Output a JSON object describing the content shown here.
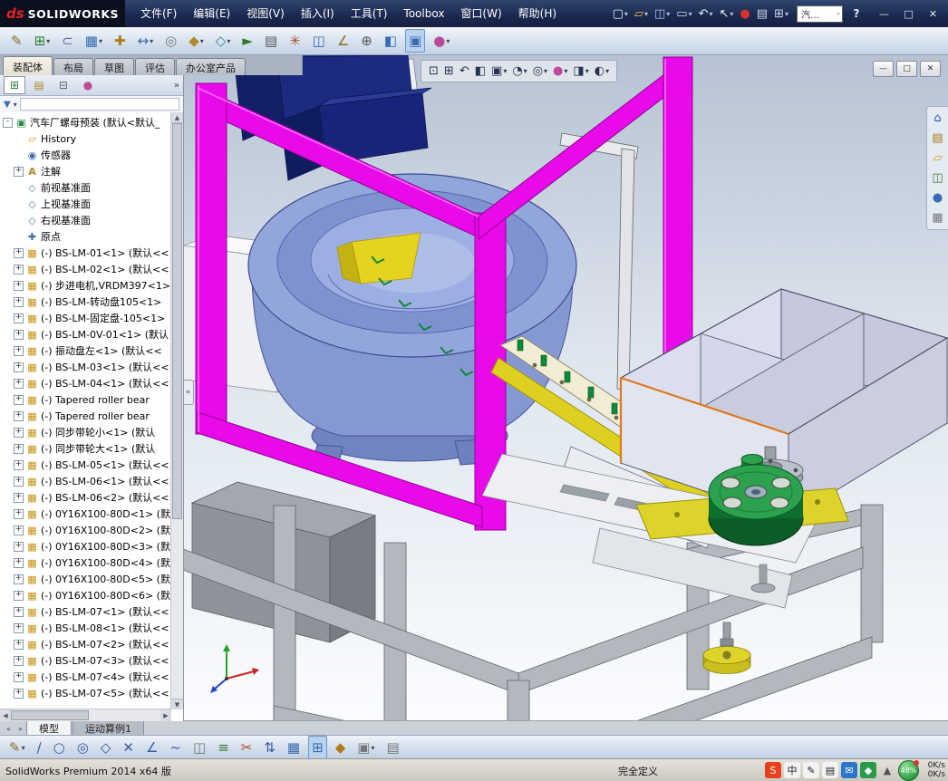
{
  "titlebar": {
    "logo_mark": "ds",
    "logo_name": "SOLIDWORKS",
    "menus": [
      "文件(F)",
      "编辑(E)",
      "视图(V)",
      "插入(I)",
      "工具(T)",
      "Toolbox",
      "窗口(W)",
      "帮助(H)"
    ],
    "qat": [
      {
        "name": "new-document-icon",
        "glyph": "▢",
        "color": "#e8ecf6",
        "dd": "▾"
      },
      {
        "name": "open-document-icon",
        "glyph": "▱",
        "color": "#f0c24a",
        "dd": "▾"
      },
      {
        "name": "save-icon",
        "glyph": "◫",
        "color": "#9fc3ee",
        "dd": "▾"
      },
      {
        "name": "print-icon",
        "glyph": "▭",
        "color": "#cdd5e4",
        "dd": "▾"
      },
      {
        "name": "undo-icon",
        "glyph": "↶",
        "color": "#e8ecf6",
        "dd": "▾"
      },
      {
        "name": "select-icon",
        "glyph": "↖",
        "color": "#eef2f8",
        "dd": "▾"
      },
      {
        "name": "record-macro-icon",
        "glyph": "●",
        "color": "#d83030"
      },
      {
        "name": "file-properties-icon",
        "glyph": "▤",
        "color": "#cdd5e4"
      },
      {
        "name": "options-icon",
        "glyph": "⊞",
        "color": "#cdd5e4",
        "dd": "▾"
      }
    ],
    "search_value": "汽…",
    "search_dd": "▾",
    "help_glyph": "?",
    "window_controls": [
      {
        "name": "minimize-button",
        "glyph": "—"
      },
      {
        "name": "maximize-button",
        "glyph": "□"
      },
      {
        "name": "close-button",
        "glyph": "✕"
      }
    ]
  },
  "toolbar2": {
    "icons": [
      {
        "name": "edit-component-icon",
        "glyph": "✎",
        "color": "#8a6d1a"
      },
      {
        "name": "insert-components-icon",
        "glyph": "⊞",
        "color": "#2f7a2f",
        "dd": "▾"
      },
      {
        "name": "mate-icon",
        "glyph": "⊂",
        "color": "#6a6a9a"
      },
      {
        "name": "linear-component-pattern-icon",
        "glyph": "▦",
        "color": "#3a6ab0",
        "dd": "▾"
      },
      {
        "name": "smart-fasteners-icon",
        "glyph": "✚",
        "color": "#b07a1a"
      },
      {
        "name": "move-component-icon",
        "glyph": "↔",
        "color": "#3a6ab0",
        "dd": "▾"
      },
      {
        "name": "show-hidden-components-icon",
        "glyph": "◎",
        "color": "#777777"
      },
      {
        "name": "assembly-features-icon",
        "glyph": "◆",
        "color": "#b08a2a",
        "dd": "▾"
      },
      {
        "name": "reference-geometry-icon",
        "glyph": "◇",
        "color": "#2a8a8a",
        "dd": "▾"
      },
      {
        "name": "new-motion-study-icon",
        "glyph": "►",
        "color": "#2a7a2a"
      },
      {
        "name": "bill-of-materials-icon",
        "glyph": "▤",
        "color": "#555555"
      },
      {
        "name": "exploded-view-icon",
        "glyph": "✳",
        "color": "#b04a2a"
      },
      {
        "name": "interference-detection-icon",
        "glyph": "◫",
        "color": "#3a6ab0"
      },
      {
        "name": "measure-icon",
        "glyph": "∠",
        "color": "#8a6d1a"
      },
      {
        "name": "mass-properties-icon",
        "glyph": "⊕",
        "color": "#555555"
      },
      {
        "name": "section-view-icon",
        "glyph": "◧",
        "color": "#3a6ab0"
      },
      {
        "name": "large-assembly-mode-icon",
        "glyph": "▣",
        "color": "#3a6ab0",
        "cls": "pressed"
      },
      {
        "name": "appearance-icon",
        "glyph": "●",
        "color": "#c04a9a",
        "dd": "▾"
      }
    ]
  },
  "command_tabs": [
    {
      "label": "装配体",
      "cls": "active"
    },
    {
      "label": "布局"
    },
    {
      "label": "草图"
    },
    {
      "label": "评估"
    },
    {
      "label": "办公室产品"
    }
  ],
  "fm": {
    "tabs": [
      {
        "name": "featuremanager-tree-tab-icon",
        "glyph": "⊞",
        "color": "#2f7a2f",
        "cls": "active"
      },
      {
        "name": "propertymanager-tab-icon",
        "glyph": "▤",
        "color": "#b08a2a"
      },
      {
        "name": "configurationmanager-tab-icon",
        "glyph": "⊟",
        "color": "#666666"
      },
      {
        "name": "displaymanager-tab-icon",
        "glyph": "●",
        "color": "#c04a9a"
      }
    ],
    "more_glyph": "»",
    "filter_glyph": "▼",
    "filter_dd": "▾"
  },
  "tree": {
    "items": [
      {
        "t": "汽车厂螺母预装 (默认<默认_",
        "g": "▣",
        "c": "#2f8a4a",
        "e": "-",
        "lv": "lv0"
      },
      {
        "t": "History",
        "g": "▱",
        "c": "#d8a020",
        "e": "",
        "lv": "lv1"
      },
      {
        "t": "传感器",
        "g": "◉",
        "c": "#3a6ab0",
        "e": "",
        "lv": "lv1"
      },
      {
        "t": "注解",
        "g": "A",
        "c": "#b08a2a",
        "e": "+",
        "lv": "lv1"
      },
      {
        "t": "前视基准面",
        "g": "◇",
        "c": "#4a8a9a",
        "e": "",
        "lv": "lv1"
      },
      {
        "t": "上视基准面",
        "g": "◇",
        "c": "#4a8a9a",
        "e": "",
        "lv": "lv1"
      },
      {
        "t": "右视基准面",
        "g": "◇",
        "c": "#4a8a9a",
        "e": "",
        "lv": "lv1"
      },
      {
        "t": "原点",
        "g": "✚",
        "c": "#3a6ab0",
        "e": "",
        "lv": "lv1"
      },
      {
        "t": "(-) BS-LM-01<1> (默认<<",
        "g": "▦",
        "c": "#c89010",
        "e": "+",
        "lv": "lv1"
      },
      {
        "t": "(-) BS-LM-02<1> (默认<<",
        "g": "▦",
        "c": "#c89010",
        "e": "+",
        "lv": "lv1"
      },
      {
        "t": "(-) 步进电机,VRDM397<1>",
        "g": "▦",
        "c": "#c89010",
        "e": "+",
        "lv": "lv1"
      },
      {
        "t": "(-) BS-LM-转动盘105<1>",
        "g": "▦",
        "c": "#c89010",
        "e": "+",
        "lv": "lv1"
      },
      {
        "t": "(-) BS-LM-固定盘-105<1>",
        "g": "▦",
        "c": "#c89010",
        "e": "+",
        "lv": "lv1"
      },
      {
        "t": "(-) BS-LM-0V-01<1> (默认",
        "g": "▦",
        "c": "#c89010",
        "e": "+",
        "lv": "lv1"
      },
      {
        "t": "(-) 振动盘左<1> (默认<<",
        "g": "▦",
        "c": "#c89010",
        "e": "+",
        "lv": "lv1"
      },
      {
        "t": "(-) BS-LM-03<1> (默认<<",
        "g": "▦",
        "c": "#c89010",
        "e": "+",
        "lv": "lv1"
      },
      {
        "t": "(-) BS-LM-04<1> (默认<<",
        "g": "▦",
        "c": "#c89010",
        "e": "+",
        "lv": "lv1"
      },
      {
        "t": "(-) Tapered roller bear",
        "g": "▦",
        "c": "#c89010",
        "e": "+",
        "lv": "lv1"
      },
      {
        "t": "(-) Tapered roller bear",
        "g": "▦",
        "c": "#c89010",
        "e": "+",
        "lv": "lv1"
      },
      {
        "t": "(-) 同步带轮小<1> (默认",
        "g": "▦",
        "c": "#c89010",
        "e": "+",
        "lv": "lv1"
      },
      {
        "t": "(-) 同步带轮大<1> (默认",
        "g": "▦",
        "c": "#c89010",
        "e": "+",
        "lv": "lv1"
      },
      {
        "t": "(-) BS-LM-05<1> (默认<<",
        "g": "▦",
        "c": "#c89010",
        "e": "+",
        "lv": "lv1"
      },
      {
        "t": "(-) BS-LM-06<1> (默认<<",
        "g": "▦",
        "c": "#c89010",
        "e": "+",
        "lv": "lv1"
      },
      {
        "t": "(-) BS-LM-06<2> (默认<<",
        "g": "▦",
        "c": "#c89010",
        "e": "+",
        "lv": "lv1"
      },
      {
        "t": "(-) 0Y16X100-80D<1> (默",
        "g": "▦",
        "c": "#c89010",
        "e": "+",
        "lv": "lv1"
      },
      {
        "t": "(-) 0Y16X100-80D<2> (默",
        "g": "▦",
        "c": "#c89010",
        "e": "+",
        "lv": "lv1"
      },
      {
        "t": "(-) 0Y16X100-80D<3> (默",
        "g": "▦",
        "c": "#c89010",
        "e": "+",
        "lv": "lv1"
      },
      {
        "t": "(-) 0Y16X100-80D<4> (默",
        "g": "▦",
        "c": "#c89010",
        "e": "+",
        "lv": "lv1"
      },
      {
        "t": "(-) 0Y16X100-80D<5> (默",
        "g": "▦",
        "c": "#c89010",
        "e": "+",
        "lv": "lv1"
      },
      {
        "t": "(-) 0Y16X100-80D<6> (默",
        "g": "▦",
        "c": "#c89010",
        "e": "+",
        "lv": "lv1"
      },
      {
        "t": "(-) BS-LM-07<1> (默认<<",
        "g": "▦",
        "c": "#c89010",
        "e": "+",
        "lv": "lv1"
      },
      {
        "t": "(-) BS-LM-08<1> (默认<<",
        "g": "▦",
        "c": "#c89010",
        "e": "+",
        "lv": "lv1"
      },
      {
        "t": "(-) BS-LM-07<2> (默认<<",
        "g": "▦",
        "c": "#c89010",
        "e": "+",
        "lv": "lv1"
      },
      {
        "t": "(-) BS-LM-07<3> (默认<<",
        "g": "▦",
        "c": "#c89010",
        "e": "+",
        "lv": "lv1"
      },
      {
        "t": "(-) BS-LM-07<4> (默认<<",
        "g": "▦",
        "c": "#c89010",
        "e": "+",
        "lv": "lv1"
      },
      {
        "t": "(-) BS-LM-07<5> (默认<<",
        "g": "▦",
        "c": "#c89010",
        "e": "+",
        "lv": "lv1"
      }
    ]
  },
  "viewport": {
    "collapse_glyph": "«",
    "hud": [
      {
        "name": "zoom-fit-icon",
        "glyph": "⊡"
      },
      {
        "name": "zoom-area-icon",
        "glyph": "⊞"
      },
      {
        "name": "previous-view-icon",
        "glyph": "↶"
      },
      {
        "name": "section-view-icon",
        "glyph": "◧"
      },
      {
        "name": "view-orientation-icon",
        "glyph": "▣",
        "dd": "▾"
      },
      {
        "name": "display-style-icon",
        "glyph": "◔",
        "dd": "▾"
      },
      {
        "name": "hide-show-items-icon",
        "glyph": "◎",
        "dd": "▾"
      },
      {
        "name": "edit-appearance-icon",
        "glyph": "●",
        "color": "#c04a9a",
        "dd": "▾"
      },
      {
        "name": "apply-scene-icon",
        "glyph": "◨",
        "dd": "▾"
      },
      {
        "name": "view-settings-icon",
        "glyph": "◐",
        "dd": "▾"
      }
    ],
    "doc_controls": [
      {
        "name": "doc-minimize-button",
        "glyph": "—"
      },
      {
        "name": "doc-restore-button",
        "glyph": "□"
      },
      {
        "name": "doc-close-button",
        "glyph": "✕"
      }
    ],
    "taskpane": [
      {
        "name": "home-icon",
        "glyph": "⌂",
        "color": "#2a5aaa"
      },
      {
        "name": "design-library-icon",
        "glyph": "▤",
        "color": "#b07a1a"
      },
      {
        "name": "file-explorer-icon",
        "glyph": "▱",
        "color": "#d8a020"
      },
      {
        "name": "view-palette-icon",
        "glyph": "◫",
        "color": "#3a7a3a"
      },
      {
        "name": "appearances-scenes-icon",
        "glyph": "●",
        "color": "#3a6ab0"
      },
      {
        "name": "custom-properties-icon",
        "glyph": "▦",
        "color": "#777777"
      }
    ]
  },
  "model_tabs": {
    "nav": [
      {
        "glyph": "«"
      },
      {
        "glyph": "»"
      }
    ],
    "tabs": [
      {
        "label": "模型",
        "cls": "active"
      },
      {
        "label": "运动算例1"
      }
    ]
  },
  "sketchbar": {
    "icons": [
      {
        "name": "sketch-icon",
        "glyph": "✎",
        "color": "#8a6d1a",
        "dd": "▾"
      },
      {
        "name": "line-icon",
        "glyph": "∕",
        "color": "#3a5a9a"
      },
      {
        "name": "circle-icon",
        "glyph": "○",
        "color": "#3a5a9a"
      },
      {
        "name": "ellipse-icon",
        "glyph": "◎",
        "color": "#3a5a9a"
      },
      {
        "name": "polygon-icon",
        "glyph": "◇",
        "color": "#3a5a9a"
      },
      {
        "name": "point-icon",
        "glyph": "✕",
        "color": "#3a5a9a"
      },
      {
        "name": "centerline-icon",
        "glyph": "∠",
        "color": "#3a5a9a"
      },
      {
        "name": "spline-icon",
        "glyph": "~",
        "color": "#3a5a9a"
      },
      {
        "name": "mirror-entities-icon",
        "glyph": "◫",
        "color": "#777777"
      },
      {
        "name": "offset-entities-icon",
        "glyph": "≡",
        "color": "#3a7a3a"
      },
      {
        "name": "trim-entities-icon",
        "glyph": "✂",
        "color": "#b04a2a"
      },
      {
        "name": "convert-entities-icon",
        "glyph": "⇅",
        "color": "#3a5a9a"
      },
      {
        "name": "linear-sketch-pattern-icon",
        "glyph": "▦",
        "color": "#3a6ab0"
      },
      {
        "name": "display-grid-icon",
        "glyph": "⊞",
        "color": "#3a6ab0",
        "cls": "pressed"
      },
      {
        "name": "snap-icon",
        "glyph": "◆",
        "color": "#b07a1a"
      },
      {
        "name": "quick-snaps-icon",
        "glyph": "▣",
        "color": "#777777",
        "dd": "▾"
      },
      {
        "name": "sketch-settings-icon",
        "glyph": "▤",
        "color": "#777777"
      }
    ]
  },
  "statusbar": {
    "left": "SolidWorks Premium 2014 x64 版",
    "status": "完全定义"
  },
  "tray": {
    "icons": [
      {
        "name": "sogou-icon",
        "glyph": "S",
        "fg": "#ffffff",
        "bg": "#e8401c"
      },
      {
        "name": "input-method-icon",
        "glyph": "中",
        "fg": "#222222",
        "bg": "#f2f2f2"
      },
      {
        "name": "pen-icon",
        "glyph": "✎",
        "fg": "#222222",
        "bg": "#f2f2f2"
      },
      {
        "name": "keyboard-icon",
        "glyph": "▤",
        "fg": "#222222",
        "bg": "#f2f2f2"
      },
      {
        "name": "message-icon",
        "glyph": "✉",
        "fg": "#ffffff",
        "bg": "#2d77c8"
      },
      {
        "name": "safety-icon",
        "glyph": "◆",
        "fg": "#ffffff",
        "bg": "#2a9a4a"
      },
      {
        "name": "tray-expand-icon",
        "glyph": "▲",
        "fg": "#555555",
        "bg": "transparent"
      }
    ],
    "ball_percent": "48%",
    "net_up": "0K/s",
    "net_down": "0K/s"
  },
  "colors": {
    "frame_magenta": "#e80ae8",
    "bowl_blue": "#93a6dc",
    "hopper_navy": "#1c2a80",
    "chute_yellow": "#ddd020",
    "wheel_green": "#2ca24e",
    "bin_lavender": "#dbdeee",
    "selection_orange": "#e07818",
    "mate_green": "#0b8a35"
  }
}
